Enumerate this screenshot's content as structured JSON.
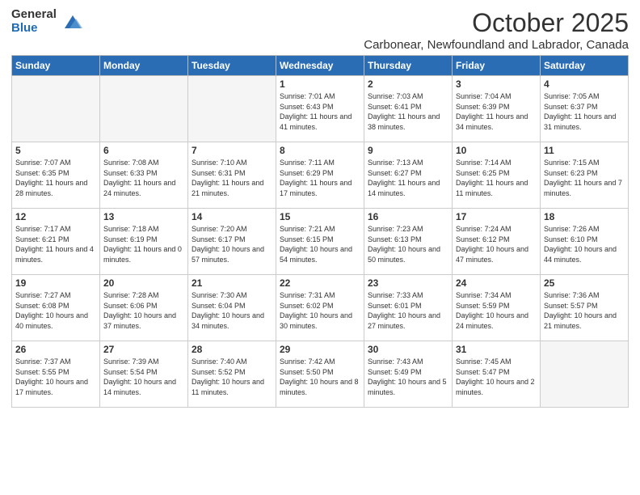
{
  "logo": {
    "general": "General",
    "blue": "Blue"
  },
  "title": "October 2025",
  "location": "Carbonear, Newfoundland and Labrador, Canada",
  "days_of_week": [
    "Sunday",
    "Monday",
    "Tuesday",
    "Wednesday",
    "Thursday",
    "Friday",
    "Saturday"
  ],
  "weeks": [
    [
      {
        "day": "",
        "info": ""
      },
      {
        "day": "",
        "info": ""
      },
      {
        "day": "",
        "info": ""
      },
      {
        "day": "1",
        "info": "Sunrise: 7:01 AM\nSunset: 6:43 PM\nDaylight: 11 hours\nand 41 minutes."
      },
      {
        "day": "2",
        "info": "Sunrise: 7:03 AM\nSunset: 6:41 PM\nDaylight: 11 hours\nand 38 minutes."
      },
      {
        "day": "3",
        "info": "Sunrise: 7:04 AM\nSunset: 6:39 PM\nDaylight: 11 hours\nand 34 minutes."
      },
      {
        "day": "4",
        "info": "Sunrise: 7:05 AM\nSunset: 6:37 PM\nDaylight: 11 hours\nand 31 minutes."
      }
    ],
    [
      {
        "day": "5",
        "info": "Sunrise: 7:07 AM\nSunset: 6:35 PM\nDaylight: 11 hours\nand 28 minutes."
      },
      {
        "day": "6",
        "info": "Sunrise: 7:08 AM\nSunset: 6:33 PM\nDaylight: 11 hours\nand 24 minutes."
      },
      {
        "day": "7",
        "info": "Sunrise: 7:10 AM\nSunset: 6:31 PM\nDaylight: 11 hours\nand 21 minutes."
      },
      {
        "day": "8",
        "info": "Sunrise: 7:11 AM\nSunset: 6:29 PM\nDaylight: 11 hours\nand 17 minutes."
      },
      {
        "day": "9",
        "info": "Sunrise: 7:13 AM\nSunset: 6:27 PM\nDaylight: 11 hours\nand 14 minutes."
      },
      {
        "day": "10",
        "info": "Sunrise: 7:14 AM\nSunset: 6:25 PM\nDaylight: 11 hours\nand 11 minutes."
      },
      {
        "day": "11",
        "info": "Sunrise: 7:15 AM\nSunset: 6:23 PM\nDaylight: 11 hours\nand 7 minutes."
      }
    ],
    [
      {
        "day": "12",
        "info": "Sunrise: 7:17 AM\nSunset: 6:21 PM\nDaylight: 11 hours\nand 4 minutes."
      },
      {
        "day": "13",
        "info": "Sunrise: 7:18 AM\nSunset: 6:19 PM\nDaylight: 11 hours\nand 0 minutes."
      },
      {
        "day": "14",
        "info": "Sunrise: 7:20 AM\nSunset: 6:17 PM\nDaylight: 10 hours\nand 57 minutes."
      },
      {
        "day": "15",
        "info": "Sunrise: 7:21 AM\nSunset: 6:15 PM\nDaylight: 10 hours\nand 54 minutes."
      },
      {
        "day": "16",
        "info": "Sunrise: 7:23 AM\nSunset: 6:13 PM\nDaylight: 10 hours\nand 50 minutes."
      },
      {
        "day": "17",
        "info": "Sunrise: 7:24 AM\nSunset: 6:12 PM\nDaylight: 10 hours\nand 47 minutes."
      },
      {
        "day": "18",
        "info": "Sunrise: 7:26 AM\nSunset: 6:10 PM\nDaylight: 10 hours\nand 44 minutes."
      }
    ],
    [
      {
        "day": "19",
        "info": "Sunrise: 7:27 AM\nSunset: 6:08 PM\nDaylight: 10 hours\nand 40 minutes."
      },
      {
        "day": "20",
        "info": "Sunrise: 7:28 AM\nSunset: 6:06 PM\nDaylight: 10 hours\nand 37 minutes."
      },
      {
        "day": "21",
        "info": "Sunrise: 7:30 AM\nSunset: 6:04 PM\nDaylight: 10 hours\nand 34 minutes."
      },
      {
        "day": "22",
        "info": "Sunrise: 7:31 AM\nSunset: 6:02 PM\nDaylight: 10 hours\nand 30 minutes."
      },
      {
        "day": "23",
        "info": "Sunrise: 7:33 AM\nSunset: 6:01 PM\nDaylight: 10 hours\nand 27 minutes."
      },
      {
        "day": "24",
        "info": "Sunrise: 7:34 AM\nSunset: 5:59 PM\nDaylight: 10 hours\nand 24 minutes."
      },
      {
        "day": "25",
        "info": "Sunrise: 7:36 AM\nSunset: 5:57 PM\nDaylight: 10 hours\nand 21 minutes."
      }
    ],
    [
      {
        "day": "26",
        "info": "Sunrise: 7:37 AM\nSunset: 5:55 PM\nDaylight: 10 hours\nand 17 minutes."
      },
      {
        "day": "27",
        "info": "Sunrise: 7:39 AM\nSunset: 5:54 PM\nDaylight: 10 hours\nand 14 minutes."
      },
      {
        "day": "28",
        "info": "Sunrise: 7:40 AM\nSunset: 5:52 PM\nDaylight: 10 hours\nand 11 minutes."
      },
      {
        "day": "29",
        "info": "Sunrise: 7:42 AM\nSunset: 5:50 PM\nDaylight: 10 hours\nand 8 minutes."
      },
      {
        "day": "30",
        "info": "Sunrise: 7:43 AM\nSunset: 5:49 PM\nDaylight: 10 hours\nand 5 minutes."
      },
      {
        "day": "31",
        "info": "Sunrise: 7:45 AM\nSunset: 5:47 PM\nDaylight: 10 hours\nand 2 minutes."
      },
      {
        "day": "",
        "info": ""
      }
    ]
  ]
}
